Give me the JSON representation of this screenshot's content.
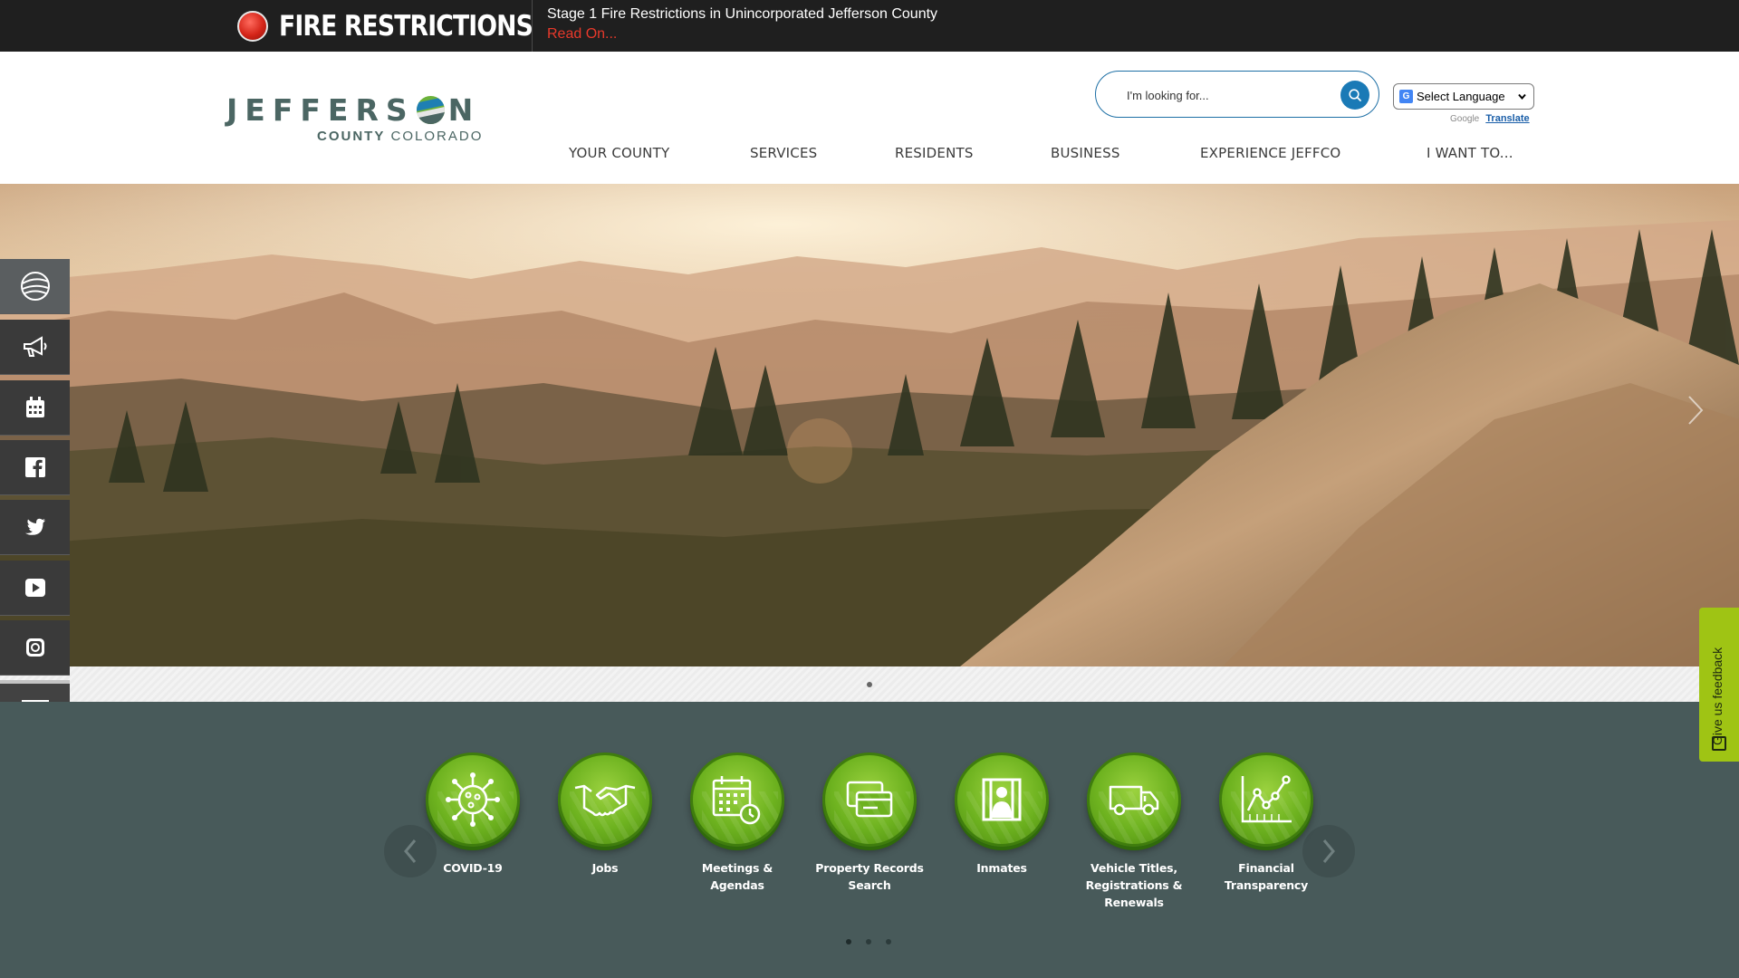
{
  "alert": {
    "title": "FIRE RESTRICTIONS",
    "message": "Stage 1 Fire Restrictions in Unincorporated Jefferson County",
    "link": "Read On..."
  },
  "logo": {
    "word_left": "JEFFERS",
    "word_right": "N",
    "sub_bold": "COUNTY",
    "sub_regular": "COLORADO"
  },
  "search": {
    "placeholder": "I'm looking for..."
  },
  "language": {
    "selected": "Select Language",
    "powered_by": "Google",
    "translate": "Translate"
  },
  "nav": [
    "YOUR COUNTY",
    "SERVICES",
    "RESIDENTS",
    "BUSINESS",
    "EXPERIENCE JEFFCO",
    "I WANT TO..."
  ],
  "side_links": [
    "globe-icon",
    "megaphone-icon",
    "calendar-icon",
    "facebook-icon",
    "twitter-icon",
    "youtube-icon",
    "instagram-icon",
    "chat-icon"
  ],
  "quick_links": [
    {
      "label": "COVID-19",
      "icon": "virus-icon"
    },
    {
      "label": "Jobs",
      "icon": "handshake-icon"
    },
    {
      "label": "Meetings & Agendas",
      "icon": "calendar-clock-icon"
    },
    {
      "label": "Property Records Search",
      "icon": "cards-icon"
    },
    {
      "label": "Inmates",
      "icon": "jail-icon"
    },
    {
      "label": "Vehicle Titles, Registrations & Renewals",
      "icon": "van-icon"
    },
    {
      "label": "Financial Transparency",
      "icon": "chart-icon"
    }
  ],
  "feedback": {
    "label": "Give us feedback"
  },
  "colors": {
    "alert_bg": "#1f1f1f",
    "brand_teal": "#4b6663",
    "quick_bg": "#485a5a",
    "icon_green": "#6db21f",
    "feedback_green": "#9fc414",
    "search_blue": "#1a7ab6"
  }
}
